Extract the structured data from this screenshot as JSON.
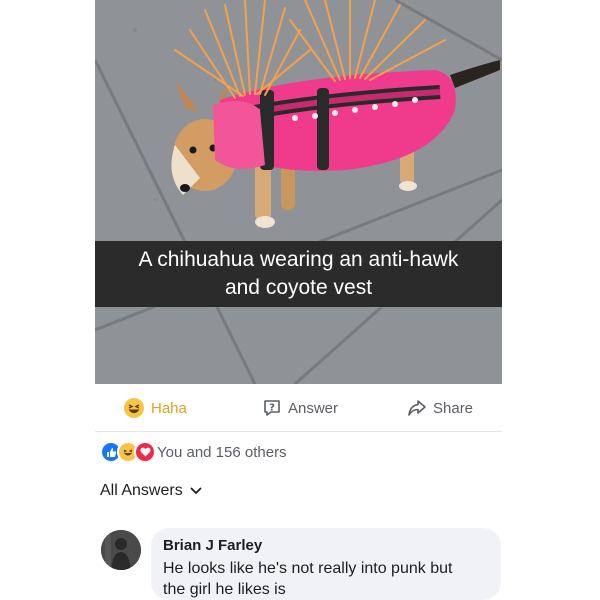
{
  "post": {
    "caption_line1": "A chihuahua wearing an anti-hawk",
    "caption_line2": "and coyote vest",
    "image_alt_subject": "chihuahua in pink spiked vest on sidewalk"
  },
  "actions": {
    "haha_label": "Haha",
    "answer_label": "Answer",
    "share_label": "Share"
  },
  "reactions": {
    "summary": "You and 156 others",
    "icons": [
      "like-icon",
      "haha-icon",
      "love-icon"
    ]
  },
  "answers": {
    "header": "All Answers"
  },
  "comment": {
    "author": "Brian J Farley",
    "text_line1": "He looks like he's not really into punk but",
    "text_line2": "the girl he likes is"
  },
  "colors": {
    "haha_accent": "#e0a21c",
    "like_blue": "#1877f2",
    "love_red": "#f0284a",
    "vest_pink": "#f03a8c",
    "spike_orange": "#f5a04a"
  }
}
